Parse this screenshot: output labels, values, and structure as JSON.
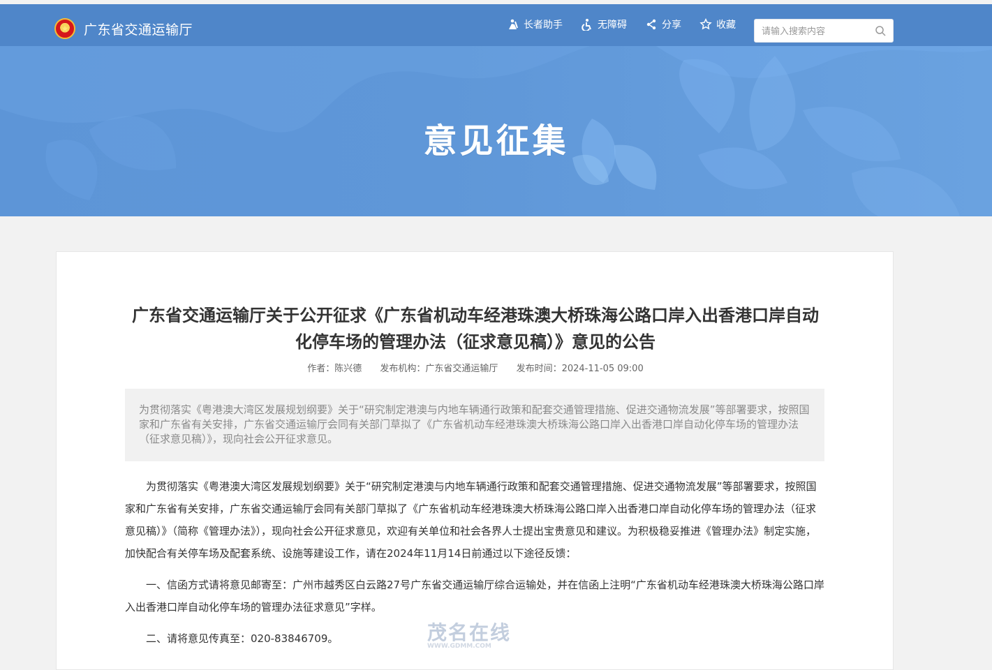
{
  "header": {
    "site_name": "广东省交通运输厅",
    "tools": [
      {
        "label": "长者助手",
        "icon": "elder-assistant-icon"
      },
      {
        "label": "无障碍",
        "icon": "accessibility-icon"
      },
      {
        "label": "分享",
        "icon": "share-icon"
      },
      {
        "label": "收藏",
        "icon": "favorite-star-icon"
      }
    ],
    "search_placeholder": "请输入搜索内容"
  },
  "banner": {
    "title": "意见征集",
    "colors": {
      "background": "#5f97d8",
      "text": "#ffffff"
    }
  },
  "article": {
    "title": "广东省交通运输厅关于公开征求《广东省机动车经港珠澳大桥珠海公路口岸入出香港口岸自动化停车场的管理办法（征求意见稿）》意见的公告",
    "meta": {
      "author": "作者：陈兴德",
      "publisher": "发布机构：广东省交通运输厅",
      "publish_time": "发布时间：2024-11-05 09:00"
    },
    "summary": "为贯彻落实《粤港澳大湾区发展规划纲要》关于“研究制定港澳与内地车辆通行政策和配套交通管理措施、促进交通物流发展”等部署要求，按照国家和广东省有关安排，广东省交通运输厅会同有关部门草拟了《广东省机动车经港珠澳大桥珠海公路口岸入出香港口岸自动化停车场的管理办法（征求意见稿）》，现向社会公开征求意见。",
    "paragraphs": [
      "为贯彻落实《粤港澳大湾区发展规划纲要》关于“研究制定港澳与内地车辆通行政策和配套交通管理措施、促进交通物流发展”等部署要求，按照国家和广东省有关安排，广东省交通运输厅会同有关部门草拟了《广东省机动车经港珠澳大桥珠海公路口岸入出香港口岸自动化停车场的管理办法（征求意见稿）》（简称《管理办法》），现向社会公开征求意见，欢迎有关单位和社会各界人士提出宝贵意见和建议。为积极稳妥推进《管理办法》制定实施，加快配合有关停车场及配套系统、设施等建设工作，请在2024年11月14日前通过以下途径反馈：",
      "一、信函方式请将意见邮寄至：广州市越秀区白云路27号广东省交通运输厅综合运输处，并在信函上注明“广东省机动车经港珠澳大桥珠海公路口岸入出香港口岸自动化停车场的管理办法征求意见”字样。",
      "二、请将意见传真至：020-83846709。"
    ]
  },
  "watermark": {
    "text": "茂名在线",
    "subtext": "WWW.GDMM.COM"
  }
}
